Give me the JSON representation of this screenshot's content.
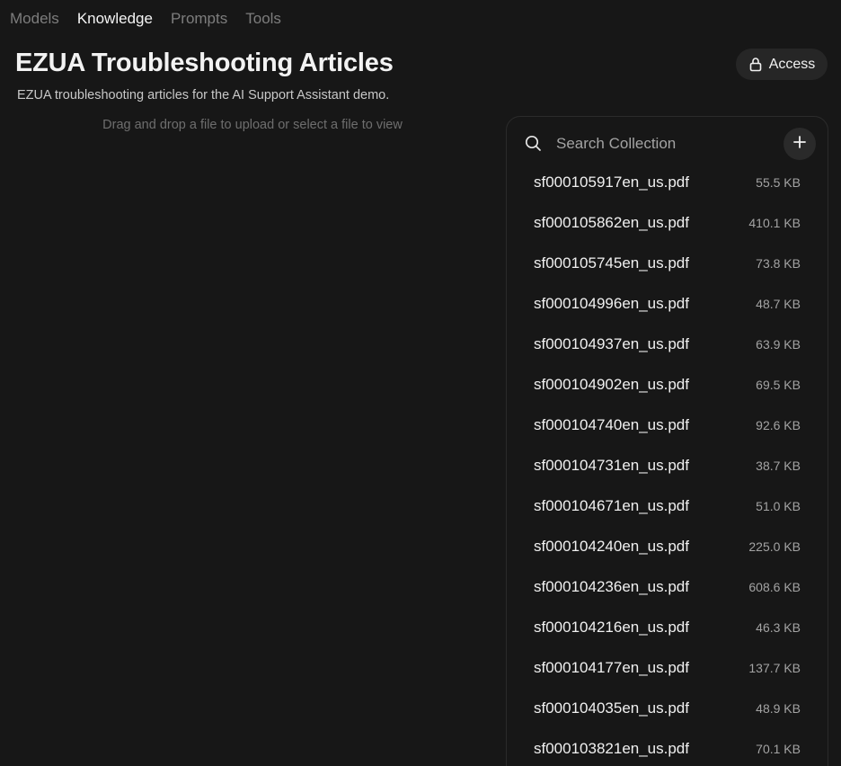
{
  "nav": {
    "items": [
      {
        "label": "Models",
        "active": false
      },
      {
        "label": "Knowledge",
        "active": true
      },
      {
        "label": "Prompts",
        "active": false
      },
      {
        "label": "Tools",
        "active": false
      }
    ]
  },
  "header": {
    "title": "EZUA Troubleshooting Articles",
    "description": "EZUA troubleshooting articles for the AI Support Assistant demo.",
    "access_label": "Access"
  },
  "dropzone": {
    "hint": "Drag and drop a file to upload or select a file to view"
  },
  "collection": {
    "search_placeholder": "Search Collection",
    "search_value": "",
    "files": [
      {
        "name": "sf000105917en_us.pdf",
        "size": "55.5 KB"
      },
      {
        "name": "sf000105862en_us.pdf",
        "size": "410.1 KB"
      },
      {
        "name": "sf000105745en_us.pdf",
        "size": "73.8 KB"
      },
      {
        "name": "sf000104996en_us.pdf",
        "size": "48.7 KB"
      },
      {
        "name": "sf000104937en_us.pdf",
        "size": "63.9 KB"
      },
      {
        "name": "sf000104902en_us.pdf",
        "size": "69.5 KB"
      },
      {
        "name": "sf000104740en_us.pdf",
        "size": "92.6 KB"
      },
      {
        "name": "sf000104731en_us.pdf",
        "size": "38.7 KB"
      },
      {
        "name": "sf000104671en_us.pdf",
        "size": "51.0 KB"
      },
      {
        "name": "sf000104240en_us.pdf",
        "size": "225.0 KB"
      },
      {
        "name": "sf000104236en_us.pdf",
        "size": "608.6 KB"
      },
      {
        "name": "sf000104216en_us.pdf",
        "size": "46.3 KB"
      },
      {
        "name": "sf000104177en_us.pdf",
        "size": "137.7 KB"
      },
      {
        "name": "sf000104035en_us.pdf",
        "size": "48.9 KB"
      },
      {
        "name": "sf000103821en_us.pdf",
        "size": "70.1 KB"
      }
    ]
  },
  "icons": {
    "search": "search-icon",
    "lock": "lock-icon",
    "add": "plus-icon"
  }
}
